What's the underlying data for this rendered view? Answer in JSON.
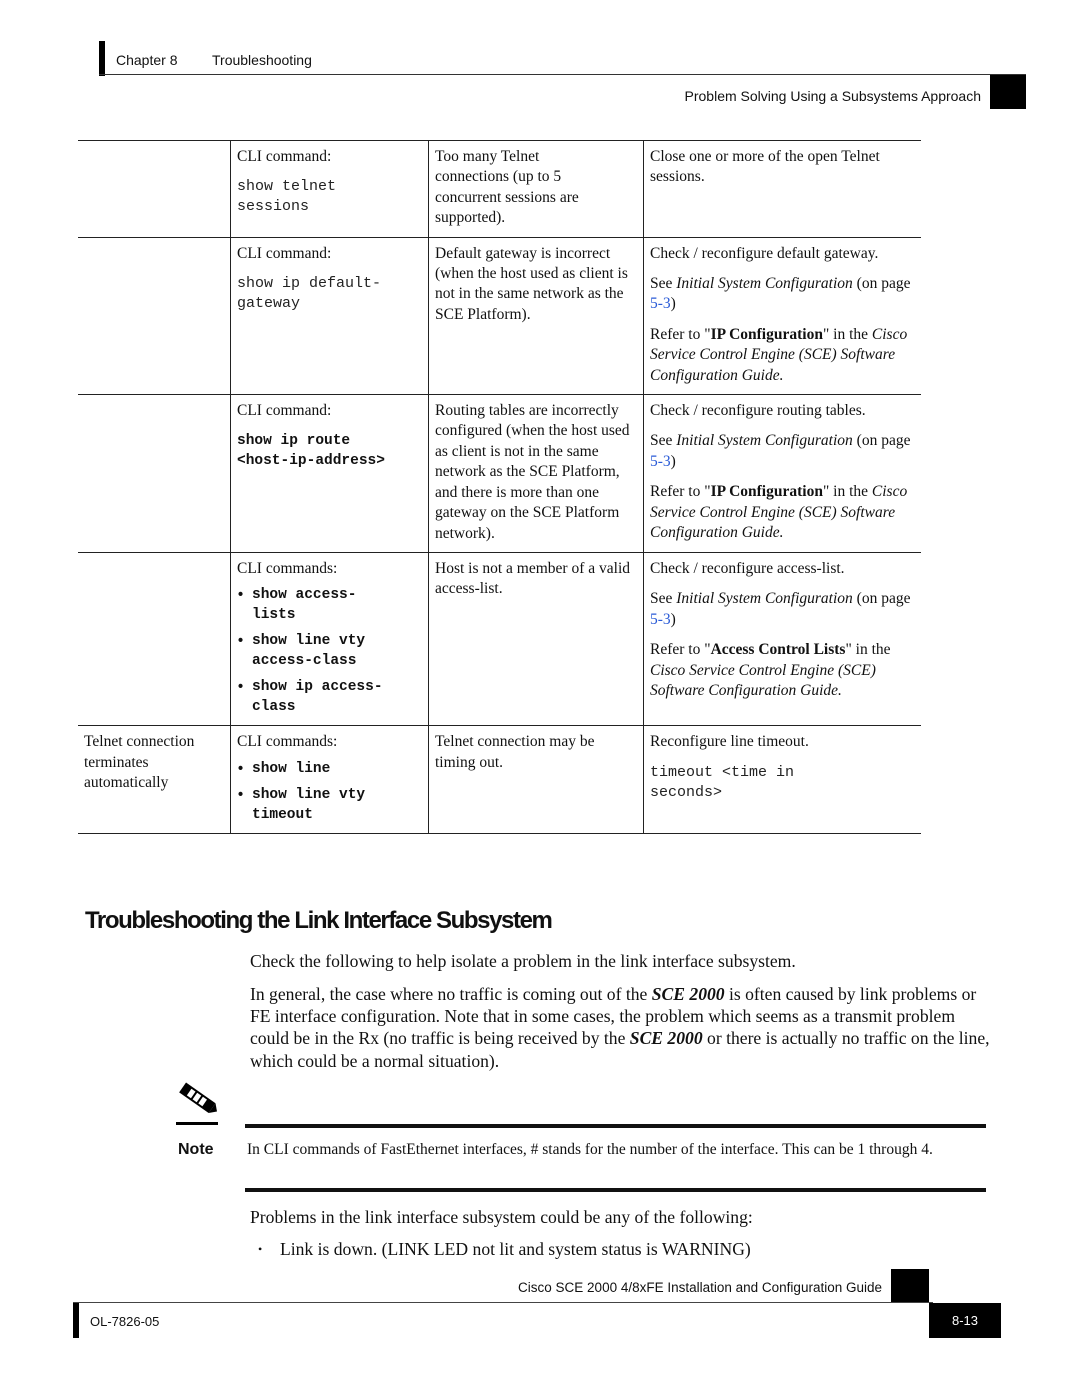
{
  "header": {
    "chapter": "Chapter 8",
    "chapter_title": "Troubleshooting",
    "section": "Problem Solving Using a Subsystems Approach"
  },
  "table": {
    "rows": [
      {
        "problem": "",
        "diagnosis_label": "CLI command:",
        "command": "show telnet sessions",
        "cause": "Too many Telnet connections (up to 5 concurrent sessions are supported).",
        "solution": "Close one or more of the open Telnet sessions."
      },
      {
        "problem": "",
        "diagnosis_label": "CLI command:",
        "command": "show ip default-gateway",
        "cause": "Default gateway is incorrect (when the host used as client is not in the same network as the SCE Platform).",
        "solution": "Check / reconfigure default gateway.",
        "see_prefix": "See ",
        "see_ref": "Initial System Configuration",
        "see_mid": " (on page ",
        "see_link": "5-3",
        "see_suffix": ")",
        "refer_prefix": "Refer to \"",
        "refer_bold": "IP Configuration",
        "refer_mid": "\" in the ",
        "refer_guide": "Cisco Service Control Engine (SCE) Software Configuration Guide",
        "refer_suffix": "."
      },
      {
        "problem": "",
        "diagnosis_label": "CLI command:",
        "command_line1": "show ip route",
        "command_line2": "<host-ip-address>",
        "cause": "Routing tables are incorrectly configured (when the host used as client is not in the same network as the SCE Platform, and there is more than one gateway on the SCE Platform network).",
        "solution": "Check / reconfigure routing tables.",
        "see_prefix": "See ",
        "see_ref": "Initial System Configuration",
        "see_mid": " (on page ",
        "see_link": "5-3",
        "see_suffix": ")",
        "refer_prefix": "Refer to \"",
        "refer_bold": "IP Configuration",
        "refer_mid": "\" in the ",
        "refer_guide": "Cisco Service Control Engine (SCE) Software Configuration Guide",
        "refer_suffix": "."
      },
      {
        "problem": "",
        "diagnosis_label": "CLI commands:",
        "commands": [
          "show access-lists",
          "show line vty access-class",
          "show ip access-class"
        ],
        "cause": "Host is not a member of a valid access-list.",
        "solution": "Check / reconfigure access-list.",
        "see_prefix": "See ",
        "see_ref": "Initial System Configuration",
        "see_mid": " (on page ",
        "see_link": "5-3",
        "see_suffix": ")",
        "refer_prefix": "Refer to \"",
        "refer_bold": "Access Control Lists",
        "refer_mid": "\" in the ",
        "refer_guide": "Cisco Service Control Engine (SCE) Software Configuration Guide",
        "refer_suffix": "."
      },
      {
        "problem": "Telnet connection terminates automatically",
        "diagnosis_label": "CLI commands:",
        "commands": [
          "show line",
          "show line vty timeout"
        ],
        "cause": "Telnet connection may be timing out.",
        "solution": "Reconfigure line timeout.",
        "solution_command": "timeout <time in seconds>"
      }
    ]
  },
  "section": {
    "title": "Troubleshooting the Link Interface Subsystem",
    "intro": "Check the following to help isolate a problem in the link interface subsystem.",
    "para_a": "In general, the case where no traffic is coming out of the ",
    "para_product": "SCE 2000",
    "para_b": " is often caused by link problems or FE interface configuration. Note that in some cases, the problem which seems as a transmit problem could be in the Rx (no traffic is being received by the ",
    "para_c": " or there is actually no traffic on the line, which could be a normal situation).",
    "note_label": "Note",
    "note_text": "In CLI commands of FastEthernet interfaces, # stands for the number of the interface. This can be 1 through 4.",
    "problems_intro": "Problems in the link interface subsystem could be any of the following:",
    "problems": [
      "Link is down. (LINK LED not lit and system status is WARNING)"
    ]
  },
  "footer": {
    "guide_title": "Cisco SCE 2000 4/8xFE Installation and Configuration Guide",
    "doc_number": "OL-7826-05",
    "page_number": "8-13"
  },
  "colors": {
    "link": "#2a5bd7",
    "text": "#111111",
    "tab": "#000000"
  }
}
